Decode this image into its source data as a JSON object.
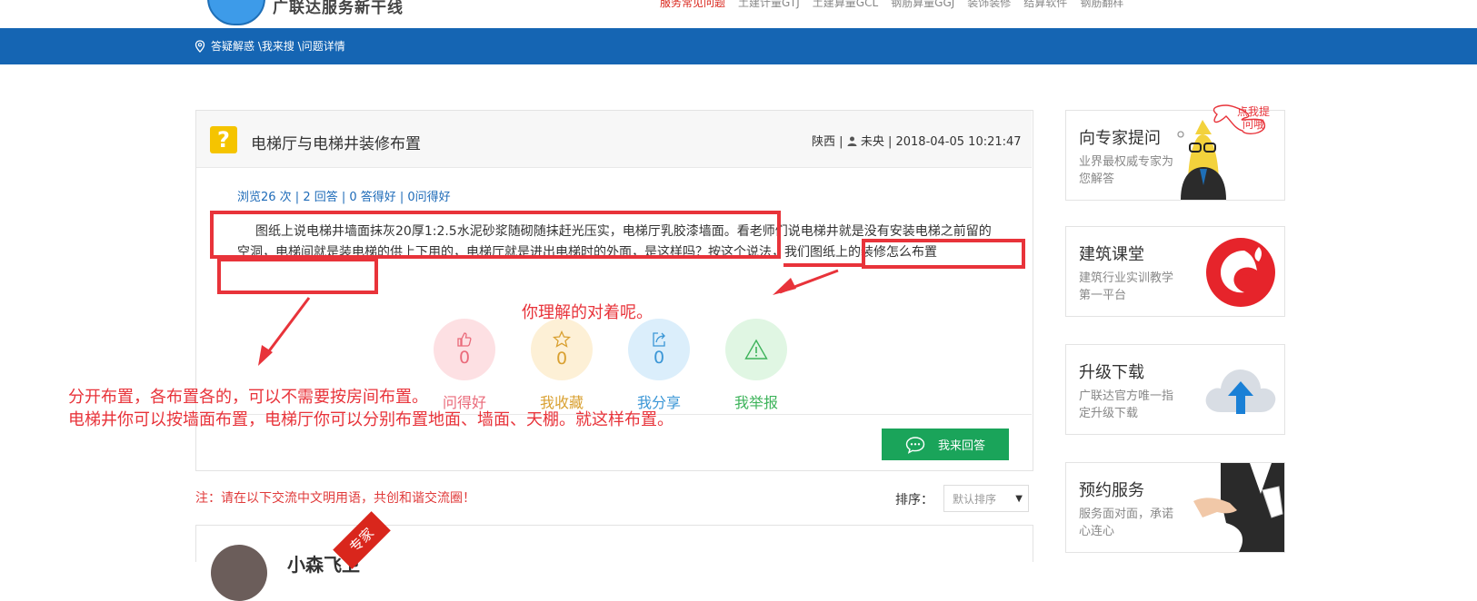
{
  "header": {
    "logo_text": "广联达服务新干线",
    "nav": [
      "服务常见问题",
      "土建计量GTJ",
      "土建算量GCL",
      "钢筋算量GGJ",
      "装饰装修",
      "结算软件",
      "钢筋翻样"
    ]
  },
  "breadcrumb": {
    "text": "答疑解惑 \\我来搜 \\问题详情"
  },
  "question": {
    "title": "电梯厅与电梯井装修布置",
    "region": "陕西",
    "author": "未央",
    "datetime": "2018-04-05 10:21:47",
    "stats": "浏览26 次 | 2 回答 | 0 答得好 | 0问得好",
    "body": "图纸上说电梯井墙面抹灰20厚1:2.5水泥砂浆随砌随抹赶光压实，电梯厅乳胶漆墙面。看老师们说电梯井就是没有安装电梯之前留的空洞，电梯间就是装电梯的供上下用的，电梯厅就是进出电梯时的外面，是这样吗？按这个说法，我们图纸上的装修怎么布置"
  },
  "actions": [
    {
      "count": "0",
      "label": "问得好",
      "icon": "thumbs-up-icon",
      "bg": "#fde0e3",
      "fg": "#ea6a7a"
    },
    {
      "count": "0",
      "label": "我收藏",
      "icon": "star-icon",
      "bg": "#fdf0d6",
      "fg": "#d9a030"
    },
    {
      "count": "0",
      "label": "我分享",
      "icon": "share-icon",
      "bg": "#dbeefb",
      "fg": "#3a96d6"
    },
    {
      "count": "",
      "label": "我举报",
      "icon": "warning-icon",
      "bg": "#e0f6e3",
      "fg": "#3db35a"
    }
  ],
  "answer_button": {
    "label": "我来回答"
  },
  "note": "注：请在以下交流中文明用语，共创和谐交流圈！",
  "sort": {
    "label": "排序：",
    "selected": "默认排序"
  },
  "comment": {
    "username": "小森飞卫",
    "badge": "专家"
  },
  "sidebar": [
    {
      "title": "向专家提问",
      "subtitle": "业界最权威专家为您解答",
      "bubble": "点我提问哦"
    },
    {
      "title": "建筑课堂",
      "subtitle": "建筑行业实训教学第一平台"
    },
    {
      "title": "升级下载",
      "subtitle": "广联达官方唯一指定升级下载"
    },
    {
      "title": "预约服务",
      "subtitle": "服务面对面，承诺心连心"
    }
  ],
  "annotations": {
    "reply_1": "你理解的对着呢。",
    "reply_2_line1": "分开布置，各布置各的，可以不需要按房间布置。",
    "reply_2_line2": "电梯井你可以按墙面布置，电梯厅你可以分别布置地面、墙面、天棚。就这样布置。"
  },
  "colors": {
    "header_blue": "#1565b3",
    "answer_green": "#1aa45a",
    "annotation_red": "#e8333a",
    "question_yellow": "#f5c400"
  }
}
